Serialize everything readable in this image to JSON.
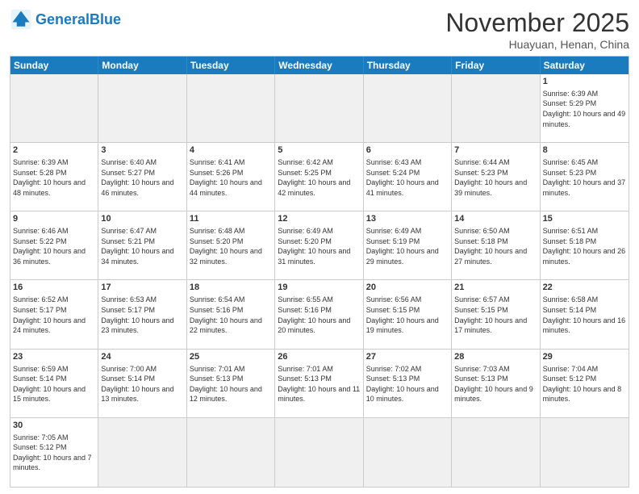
{
  "header": {
    "logo_general": "General",
    "logo_blue": "Blue",
    "title": "November 2025",
    "location": "Huayuan, Henan, China"
  },
  "days": [
    "Sunday",
    "Monday",
    "Tuesday",
    "Wednesday",
    "Thursday",
    "Friday",
    "Saturday"
  ],
  "cells": [
    {
      "date": "",
      "empty": true
    },
    {
      "date": "",
      "empty": true
    },
    {
      "date": "",
      "empty": true
    },
    {
      "date": "",
      "empty": true
    },
    {
      "date": "",
      "empty": true
    },
    {
      "date": "",
      "empty": true
    },
    {
      "date": "1",
      "sunrise": "Sunrise: 6:39 AM",
      "sunset": "Sunset: 5:29 PM",
      "daylight": "Daylight: 10 hours and 49 minutes."
    },
    {
      "date": "2",
      "sunrise": "Sunrise: 6:39 AM",
      "sunset": "Sunset: 5:28 PM",
      "daylight": "Daylight: 10 hours and 48 minutes."
    },
    {
      "date": "3",
      "sunrise": "Sunrise: 6:40 AM",
      "sunset": "Sunset: 5:27 PM",
      "daylight": "Daylight: 10 hours and 46 minutes."
    },
    {
      "date": "4",
      "sunrise": "Sunrise: 6:41 AM",
      "sunset": "Sunset: 5:26 PM",
      "daylight": "Daylight: 10 hours and 44 minutes."
    },
    {
      "date": "5",
      "sunrise": "Sunrise: 6:42 AM",
      "sunset": "Sunset: 5:25 PM",
      "daylight": "Daylight: 10 hours and 42 minutes."
    },
    {
      "date": "6",
      "sunrise": "Sunrise: 6:43 AM",
      "sunset": "Sunset: 5:24 PM",
      "daylight": "Daylight: 10 hours and 41 minutes."
    },
    {
      "date": "7",
      "sunrise": "Sunrise: 6:44 AM",
      "sunset": "Sunset: 5:23 PM",
      "daylight": "Daylight: 10 hours and 39 minutes."
    },
    {
      "date": "8",
      "sunrise": "Sunrise: 6:45 AM",
      "sunset": "Sunset: 5:23 PM",
      "daylight": "Daylight: 10 hours and 37 minutes."
    },
    {
      "date": "9",
      "sunrise": "Sunrise: 6:46 AM",
      "sunset": "Sunset: 5:22 PM",
      "daylight": "Daylight: 10 hours and 36 minutes."
    },
    {
      "date": "10",
      "sunrise": "Sunrise: 6:47 AM",
      "sunset": "Sunset: 5:21 PM",
      "daylight": "Daylight: 10 hours and 34 minutes."
    },
    {
      "date": "11",
      "sunrise": "Sunrise: 6:48 AM",
      "sunset": "Sunset: 5:20 PM",
      "daylight": "Daylight: 10 hours and 32 minutes."
    },
    {
      "date": "12",
      "sunrise": "Sunrise: 6:49 AM",
      "sunset": "Sunset: 5:20 PM",
      "daylight": "Daylight: 10 hours and 31 minutes."
    },
    {
      "date": "13",
      "sunrise": "Sunrise: 6:49 AM",
      "sunset": "Sunset: 5:19 PM",
      "daylight": "Daylight: 10 hours and 29 minutes."
    },
    {
      "date": "14",
      "sunrise": "Sunrise: 6:50 AM",
      "sunset": "Sunset: 5:18 PM",
      "daylight": "Daylight: 10 hours and 27 minutes."
    },
    {
      "date": "15",
      "sunrise": "Sunrise: 6:51 AM",
      "sunset": "Sunset: 5:18 PM",
      "daylight": "Daylight: 10 hours and 26 minutes."
    },
    {
      "date": "16",
      "sunrise": "Sunrise: 6:52 AM",
      "sunset": "Sunset: 5:17 PM",
      "daylight": "Daylight: 10 hours and 24 minutes."
    },
    {
      "date": "17",
      "sunrise": "Sunrise: 6:53 AM",
      "sunset": "Sunset: 5:17 PM",
      "daylight": "Daylight: 10 hours and 23 minutes."
    },
    {
      "date": "18",
      "sunrise": "Sunrise: 6:54 AM",
      "sunset": "Sunset: 5:16 PM",
      "daylight": "Daylight: 10 hours and 22 minutes."
    },
    {
      "date": "19",
      "sunrise": "Sunrise: 6:55 AM",
      "sunset": "Sunset: 5:16 PM",
      "daylight": "Daylight: 10 hours and 20 minutes."
    },
    {
      "date": "20",
      "sunrise": "Sunrise: 6:56 AM",
      "sunset": "Sunset: 5:15 PM",
      "daylight": "Daylight: 10 hours and 19 minutes."
    },
    {
      "date": "21",
      "sunrise": "Sunrise: 6:57 AM",
      "sunset": "Sunset: 5:15 PM",
      "daylight": "Daylight: 10 hours and 17 minutes."
    },
    {
      "date": "22",
      "sunrise": "Sunrise: 6:58 AM",
      "sunset": "Sunset: 5:14 PM",
      "daylight": "Daylight: 10 hours and 16 minutes."
    },
    {
      "date": "23",
      "sunrise": "Sunrise: 6:59 AM",
      "sunset": "Sunset: 5:14 PM",
      "daylight": "Daylight: 10 hours and 15 minutes."
    },
    {
      "date": "24",
      "sunrise": "Sunrise: 7:00 AM",
      "sunset": "Sunset: 5:14 PM",
      "daylight": "Daylight: 10 hours and 13 minutes."
    },
    {
      "date": "25",
      "sunrise": "Sunrise: 7:01 AM",
      "sunset": "Sunset: 5:13 PM",
      "daylight": "Daylight: 10 hours and 12 minutes."
    },
    {
      "date": "26",
      "sunrise": "Sunrise: 7:01 AM",
      "sunset": "Sunset: 5:13 PM",
      "daylight": "Daylight: 10 hours and 11 minutes."
    },
    {
      "date": "27",
      "sunrise": "Sunrise: 7:02 AM",
      "sunset": "Sunset: 5:13 PM",
      "daylight": "Daylight: 10 hours and 10 minutes."
    },
    {
      "date": "28",
      "sunrise": "Sunrise: 7:03 AM",
      "sunset": "Sunset: 5:13 PM",
      "daylight": "Daylight: 10 hours and 9 minutes."
    },
    {
      "date": "29",
      "sunrise": "Sunrise: 7:04 AM",
      "sunset": "Sunset: 5:12 PM",
      "daylight": "Daylight: 10 hours and 8 minutes."
    },
    {
      "date": "30",
      "sunrise": "Sunrise: 7:05 AM",
      "sunset": "Sunset: 5:12 PM",
      "daylight": "Daylight: 10 hours and 7 minutes."
    },
    {
      "date": "",
      "empty": true
    },
    {
      "date": "",
      "empty": true
    },
    {
      "date": "",
      "empty": true
    },
    {
      "date": "",
      "empty": true
    },
    {
      "date": "",
      "empty": true
    },
    {
      "date": "",
      "empty": true
    }
  ]
}
